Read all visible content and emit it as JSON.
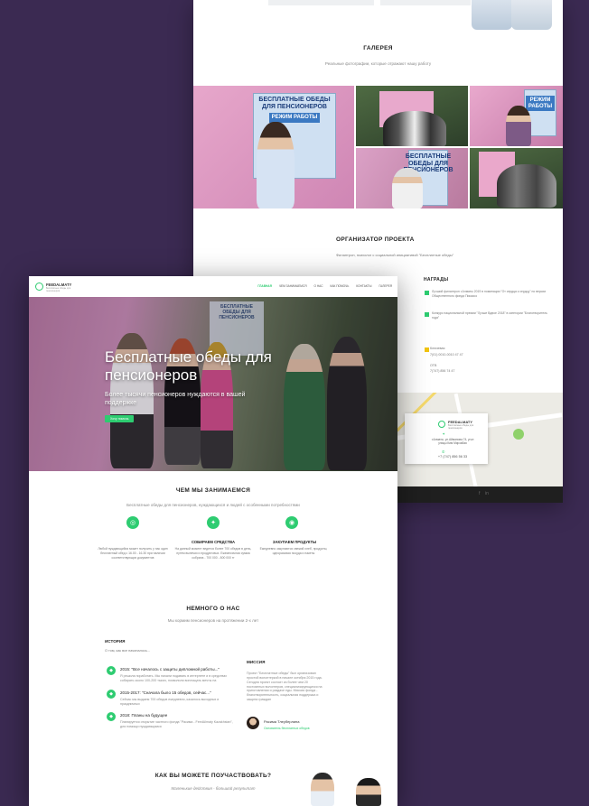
{
  "back_page": {
    "gallery": {
      "title": "ГАЛЕРЕЯ",
      "subtitle": "Реальные фотографии, которые отражают нашу работу",
      "sign_text": "БЕСПЛАТНЫЕ ОБЕДЫ ДЛЯ ПЕНСИОНЕРОВ",
      "sign_mode": "РЕЖИМ РАБОТЫ"
    },
    "organizer": {
      "title": "ОРГАНИЗАТОР ПРОЕКТА",
      "subtitle": "Филантроп, психолог с социальной инициативой \"Бесплатные обеды\""
    },
    "awards": {
      "title": "НАГРАДЫ",
      "items": [
        "Лучший филантроп г.Алматы 2019 в номинации \"От сердца к сердцу\" по версии Общественного фонда Пикассо",
        "Конкурс национальной премии \"Лучше Вдвое 2018\" в категории \"Благотворитель года\""
      ]
    },
    "contacts": {
      "label_1": "Ключевая",
      "value_1": "7(01) 0010-0010 47 47",
      "label_2": "ОТВ",
      "value_2": "7(747) 856 74 47"
    },
    "map_card": {
      "logo": "FEEDALMATY",
      "tagline": "Бесплатные обеды для пенсионеров",
      "address": "г.Алматы, ул.Айманова 74, угол улицы Ким Мирзабая",
      "phone": "+7 (747) 856 56 33"
    },
    "footer_social": [
      "f",
      "in"
    ]
  },
  "front_page": {
    "logo": {
      "name": "FEEDALMATY",
      "tagline": "Бесплатные обеды для пенсионеров"
    },
    "nav": [
      "ГЛАВНАЯ",
      "ЧЕМ ЗАНИМАЕМСЯ",
      "О НАС",
      "КАК ПОМОЧЬ",
      "КОНТАКТЫ",
      "ГАЛЕРЕЯ"
    ],
    "hero": {
      "title": "Бесплатные обеды для пенсионеров",
      "subtitle": "Более тысячи пенсионеров нуждаются в вашей поддержке",
      "button": "Хочу помочь"
    },
    "what_we_do": {
      "title": "ЧЕМ МЫ ЗАНИМАЕМСЯ",
      "subtitle": "Бесплатные обеды для пенсионеров, нуждающихся и людей с особенными потребностями",
      "items": [
        {
          "title": "",
          "text": "Любой нуждающийся может получить у нас один бесплатный обед с 16.00 - 16.30 при наличии соответствующих документов"
        },
        {
          "title": "СОБИРАЕМ СРЕДСТВА",
          "text": "На данный момент ведется более 700 обедов в день, путем выпечки и продуктовых. Ежемесячная сумма собрана - 700 000 - 800 000 тг"
        },
        {
          "title": "ЗАКУПАЕМ ПРОДУКТЫ",
          "text": "Ежедневно закупаются свежий хлеб, продукты, одноразовая посуда и пакеты"
        }
      ]
    },
    "about": {
      "title": "НЕМНОГО О НАС",
      "subtitle": "Мы кормим пенсионеров на протяжении 2-х лет",
      "history_title": "ИСТОРИЯ",
      "history_sub": "О том, как все начиналось...",
      "timeline": [
        {
          "head": "2015: \"Все началось с защиты дипломной работы...\"",
          "text": "Я решила поработать. Мы начали подавать в интернете и в средствах собирать около 100-200 тысяч, позволили воплощать мечты на"
        },
        {
          "head": "2015-2017: \"Сначала было 15 обедов, сейчас...\"",
          "text": "Сейчас мы выдаем 700 обедов ежедневно, казалось выходных и праздничных"
        },
        {
          "head": "2018: Планы на будущее",
          "text": "Планируется открытие частного фонда \"Расима - FeedAlmaty Kazakhstan\", для помощи нуждающимся"
        }
      ],
      "mission_title": "МИССИЯ",
      "mission_text": "Проект \"Бесплатные обеды\" был организован простой волонтеркой в начале октября 2015 года. Сегодня проект состоит из более чем 20 постоянных волонтеров, специализирующихся на приготовлении и раздаче еды. Миссия фонда - благотворительность, социальная поддержка и защита граждан",
      "person_name": "Расима Тлеуберлина",
      "person_role": "Основатель бесплатных обедов"
    },
    "how_help": {
      "title": "КАК ВЫ МОЖЕТЕ ПОУЧАСТВОВАТЬ?",
      "subtitle": "Маленькие действия - большой результат"
    }
  },
  "colors": {
    "background": "#3b2a52",
    "accent": "#2ecc71",
    "pink": "#e7a7cb"
  }
}
